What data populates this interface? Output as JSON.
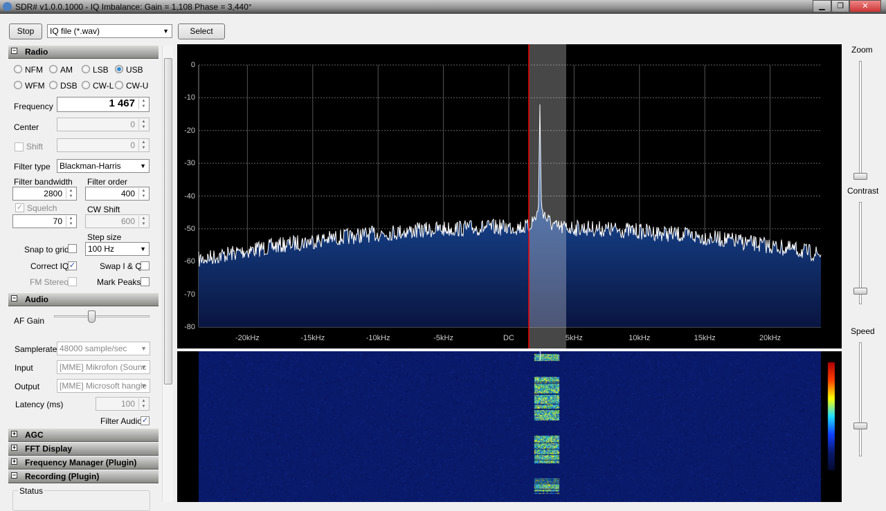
{
  "window": {
    "title": "SDR# v1.0.0.1000 - IQ Imbalance: Gain = 1,108 Phase = 3,440°",
    "minimize": "▁",
    "maximize": "❐",
    "close": "✕"
  },
  "toolbar": {
    "stop": "Stop",
    "source": "IQ file (*.wav)",
    "select": "Select"
  },
  "radio": {
    "header": "Radio",
    "modes": [
      "NFM",
      "AM",
      "LSB",
      "USB",
      "WFM",
      "DSB",
      "CW-L",
      "CW-U"
    ],
    "selected_mode": "USB",
    "frequency_label": "Frequency",
    "frequency": "1 467",
    "center_label": "Center",
    "center": "0",
    "shift_label": "Shift",
    "shift": "0",
    "filter_type_label": "Filter type",
    "filter_type": "Blackman-Harris",
    "filter_bw_label": "Filter bandwidth",
    "filter_bw": "2800",
    "filter_order_label": "Filter order",
    "filter_order": "400",
    "squelch_label": "Squelch",
    "squelch": "70",
    "cw_shift_label": "CW Shift",
    "cw_shift": "600",
    "step_size_label": "Step size",
    "step_size": "100 Hz",
    "snap_label": "Snap to grid",
    "correct_iq_label": "Correct IQ",
    "swap_label": "Swap I & Q",
    "fm_stereo_label": "FM Stereo",
    "mark_peaks_label": "Mark Peaks",
    "correct_iq": true,
    "snap": false,
    "swap": false,
    "fm_stereo": false,
    "mark_peaks": false,
    "squelch_on": true
  },
  "audio": {
    "header": "Audio",
    "af_gain_label": "AF Gain",
    "af_gain": 0.37,
    "samplerate_label": "Samplerate",
    "samplerate": "48000 sample/sec",
    "input_label": "Input",
    "input": "[MME] Mikrofon (Sounc",
    "output_label": "Output",
    "output": "[MME] Microsoft hangle",
    "latency_label": "Latency (ms)",
    "latency": "100",
    "filter_audio_label": "Filter Audio",
    "filter_audio": true
  },
  "panels": {
    "agc": "AGC",
    "fft": "FFT Display",
    "freq_mgr": "Frequency Manager (Plugin)",
    "recording": "Recording (Plugin)",
    "status": "Status"
  },
  "spectrum": {
    "y_ticks": [
      "0",
      "-10",
      "-20",
      "-30",
      "-40",
      "-50",
      "-60",
      "-70",
      "-80"
    ],
    "x_ticks": [
      "-20kHz",
      "-15kHz",
      "-10kHz",
      "-5kHz",
      "DC",
      "5kHz",
      "10kHz",
      "15kHz",
      "20kHz"
    ]
  },
  "right": {
    "zoom_label": "Zoom",
    "contrast_label": "Contrast",
    "speed_label": "Speed",
    "zoom": 0.0,
    "contrast": 0.1,
    "speed": 0.25
  },
  "colors": {
    "spectrum_fill": "#1f5aa8",
    "tuning_line": "#ff0000"
  }
}
